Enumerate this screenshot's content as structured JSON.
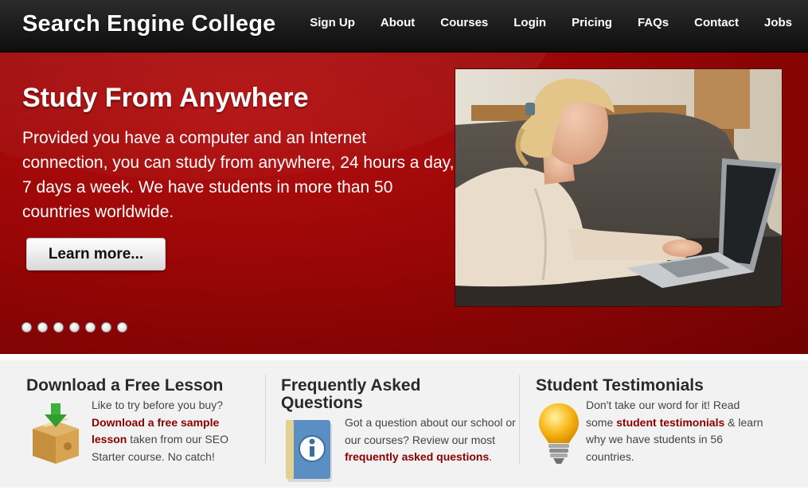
{
  "header": {
    "brand": "Search Engine College",
    "nav": [
      "Sign Up",
      "About",
      "Courses",
      "Login",
      "Pricing",
      "FAQs",
      "Contact",
      "Jobs"
    ]
  },
  "hero": {
    "title": "Study From Anywhere",
    "text": "Provided you have a computer and an Internet connection, you can study from anywhere, 24 hours a day, 7 days a week. We have students in more than 50 countries worldwide.",
    "button_label": "Learn more...",
    "slide_count": 7
  },
  "columns": [
    {
      "title": "Download a Free Lesson",
      "icon": "package-download-icon",
      "text_before": "Like to try before you buy? ",
      "link": "Download a free sample lesson",
      "text_after": " taken from our SEO Starter course. No catch!"
    },
    {
      "title": "Frequently Asked Questions",
      "icon": "info-book-icon",
      "text_before": "Got a question about our school or our courses? Review our most ",
      "link": "frequently asked questions",
      "text_after": "."
    },
    {
      "title": "Student Testimonials",
      "icon": "lightbulb-icon",
      "text_before": "Don't take our word for it! Read some ",
      "link": "student testimonials",
      "text_after": " & learn why we have students in 56 countries."
    }
  ],
  "colors": {
    "header_bg": "#111111",
    "hero_red": "#9a0606",
    "link_red": "#8a0000",
    "lower_bg": "#f2f2f2"
  }
}
